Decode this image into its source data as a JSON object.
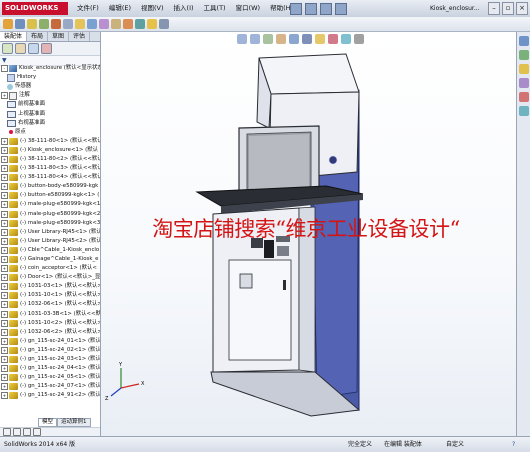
{
  "app": {
    "logo_text": "SOLIDWORKS",
    "menu": [
      "文件(F)",
      "编辑(E)",
      "视图(V)",
      "插入(I)",
      "工具(T)",
      "窗口(W)",
      "帮助(H)"
    ],
    "doc_title": "Kiosk_enclosur..."
  },
  "panel": {
    "tabs": [
      "装配体",
      "布局",
      "草图",
      "评估"
    ],
    "filter_icon": "filter-icon",
    "tree": [
      {
        "label": "Kiosk_enclosure (默认<显示状态-1>)",
        "icon": "assembly",
        "exp": "-"
      },
      {
        "label": "History",
        "icon": "history",
        "exp": ""
      },
      {
        "label": "传感器",
        "icon": "sensor",
        "exp": ""
      },
      {
        "label": "注解",
        "icon": "annotation",
        "exp": "+"
      },
      {
        "label": "前视基准面",
        "icon": "plane",
        "exp": ""
      },
      {
        "label": "上视基准面",
        "icon": "plane",
        "exp": ""
      },
      {
        "label": "右视基准面",
        "icon": "plane",
        "exp": ""
      },
      {
        "label": "原点",
        "icon": "origin",
        "exp": ""
      },
      {
        "label": "(-) 38-111-80<1> (默认<<默认",
        "icon": "part",
        "exp": "+"
      },
      {
        "label": "(-) Kiosk_enclosure<1> (默认",
        "icon": "part",
        "exp": "+"
      },
      {
        "label": "(-) 38-111-80<2> (默认<<默认",
        "icon": "part",
        "exp": "+"
      },
      {
        "label": "(-) 38-111-80<3> (默认<<默认",
        "icon": "part",
        "exp": "+"
      },
      {
        "label": "(-) 38-111-80<4> (默认<<默认",
        "icon": "part",
        "exp": "+"
      },
      {
        "label": "(-) button-body-e580999-kgk",
        "icon": "part",
        "exp": "+"
      },
      {
        "label": "(-) button-e580999-kgk<1> (",
        "icon": "part",
        "exp": "+"
      },
      {
        "label": "(-) male-plug-e580999-kgk<1",
        "icon": "part",
        "exp": "+"
      },
      {
        "label": "(-) male-plug-e580999-kgk<2",
        "icon": "part",
        "exp": "+"
      },
      {
        "label": "(-) male-plug-e580999-kgk<3",
        "icon": "part",
        "exp": "+"
      },
      {
        "label": "(-) User Library-RJ45<1> (默认",
        "icon": "part",
        "exp": "+"
      },
      {
        "label": "(-) User Library-RJ45<2> (默认",
        "icon": "part",
        "exp": "+"
      },
      {
        "label": "(-) Cble^Cable_1-Kiosk_enclo",
        "icon": "part",
        "exp": "+"
      },
      {
        "label": "(-) Gainage^Cable_1-Kiosk_e",
        "icon": "part",
        "exp": "+"
      },
      {
        "label": "(-) coin_acceptor<1> (默认<",
        "icon": "part",
        "exp": "+"
      },
      {
        "label": "(-) Door<1> (默认<<默认>_显",
        "icon": "part",
        "exp": "+"
      },
      {
        "label": "(-) 1031-03<1> (默认<<默认>_",
        "icon": "part",
        "exp": "+"
      },
      {
        "label": "(-) 1031-10<1> (默认<<默认>_",
        "icon": "part",
        "exp": "+"
      },
      {
        "label": "(-) 1032-06<1> (默认<<默认>_",
        "icon": "part",
        "exp": "+"
      },
      {
        "label": "(-) 1031-03-3B<1> (默认<<默认",
        "icon": "part",
        "exp": "+"
      },
      {
        "label": "(-) 1031-10<2> (默认<<默认>_",
        "icon": "part",
        "exp": "+"
      },
      {
        "label": "(-) 1032-06<2> (默认<<默认>_",
        "icon": "part",
        "exp": "+"
      },
      {
        "label": "(-) gn_115-sc-24_01<1> (默认",
        "icon": "part",
        "exp": "+"
      },
      {
        "label": "(-) gn_115-sc-24_02<1> (默认",
        "icon": "part",
        "exp": "+"
      },
      {
        "label": "(-) gn_115-sc-24_03<1> (默认",
        "icon": "part",
        "exp": "+"
      },
      {
        "label": "(-) gn_115-sc-24_04<1> (默认",
        "icon": "part",
        "exp": "+"
      },
      {
        "label": "(-) gn_115-sc-24_05<1> (默认",
        "icon": "part",
        "exp": "+"
      },
      {
        "label": "(-) gn_115-sc-24_07<1> (默认",
        "icon": "part",
        "exp": "+"
      },
      {
        "label": "(-) gn_115-sc-24_91<2> (默认",
        "icon": "part",
        "exp": "+"
      }
    ],
    "bottom_tabs": [
      "模型",
      "运动算例1"
    ]
  },
  "viewport": {
    "watermark": "淘宝店铺搜索“维京工业设备设计“",
    "triad": {
      "x": "X",
      "y": "Y",
      "z": "Z"
    },
    "colors": {
      "body_blue": "#4b5aa6",
      "panel_light": "#eef0f5",
      "screen_gray": "#9a9ea6",
      "desk_dark": "#2a2d34"
    }
  },
  "status": {
    "version": "SolidWorks 2014 x64 版",
    "state": "完全定义",
    "mode": "在编辑 装配体",
    "units": "自定义"
  },
  "colors": {
    "logo_red": "#c8102e",
    "watermark_red": "#d41414"
  }
}
